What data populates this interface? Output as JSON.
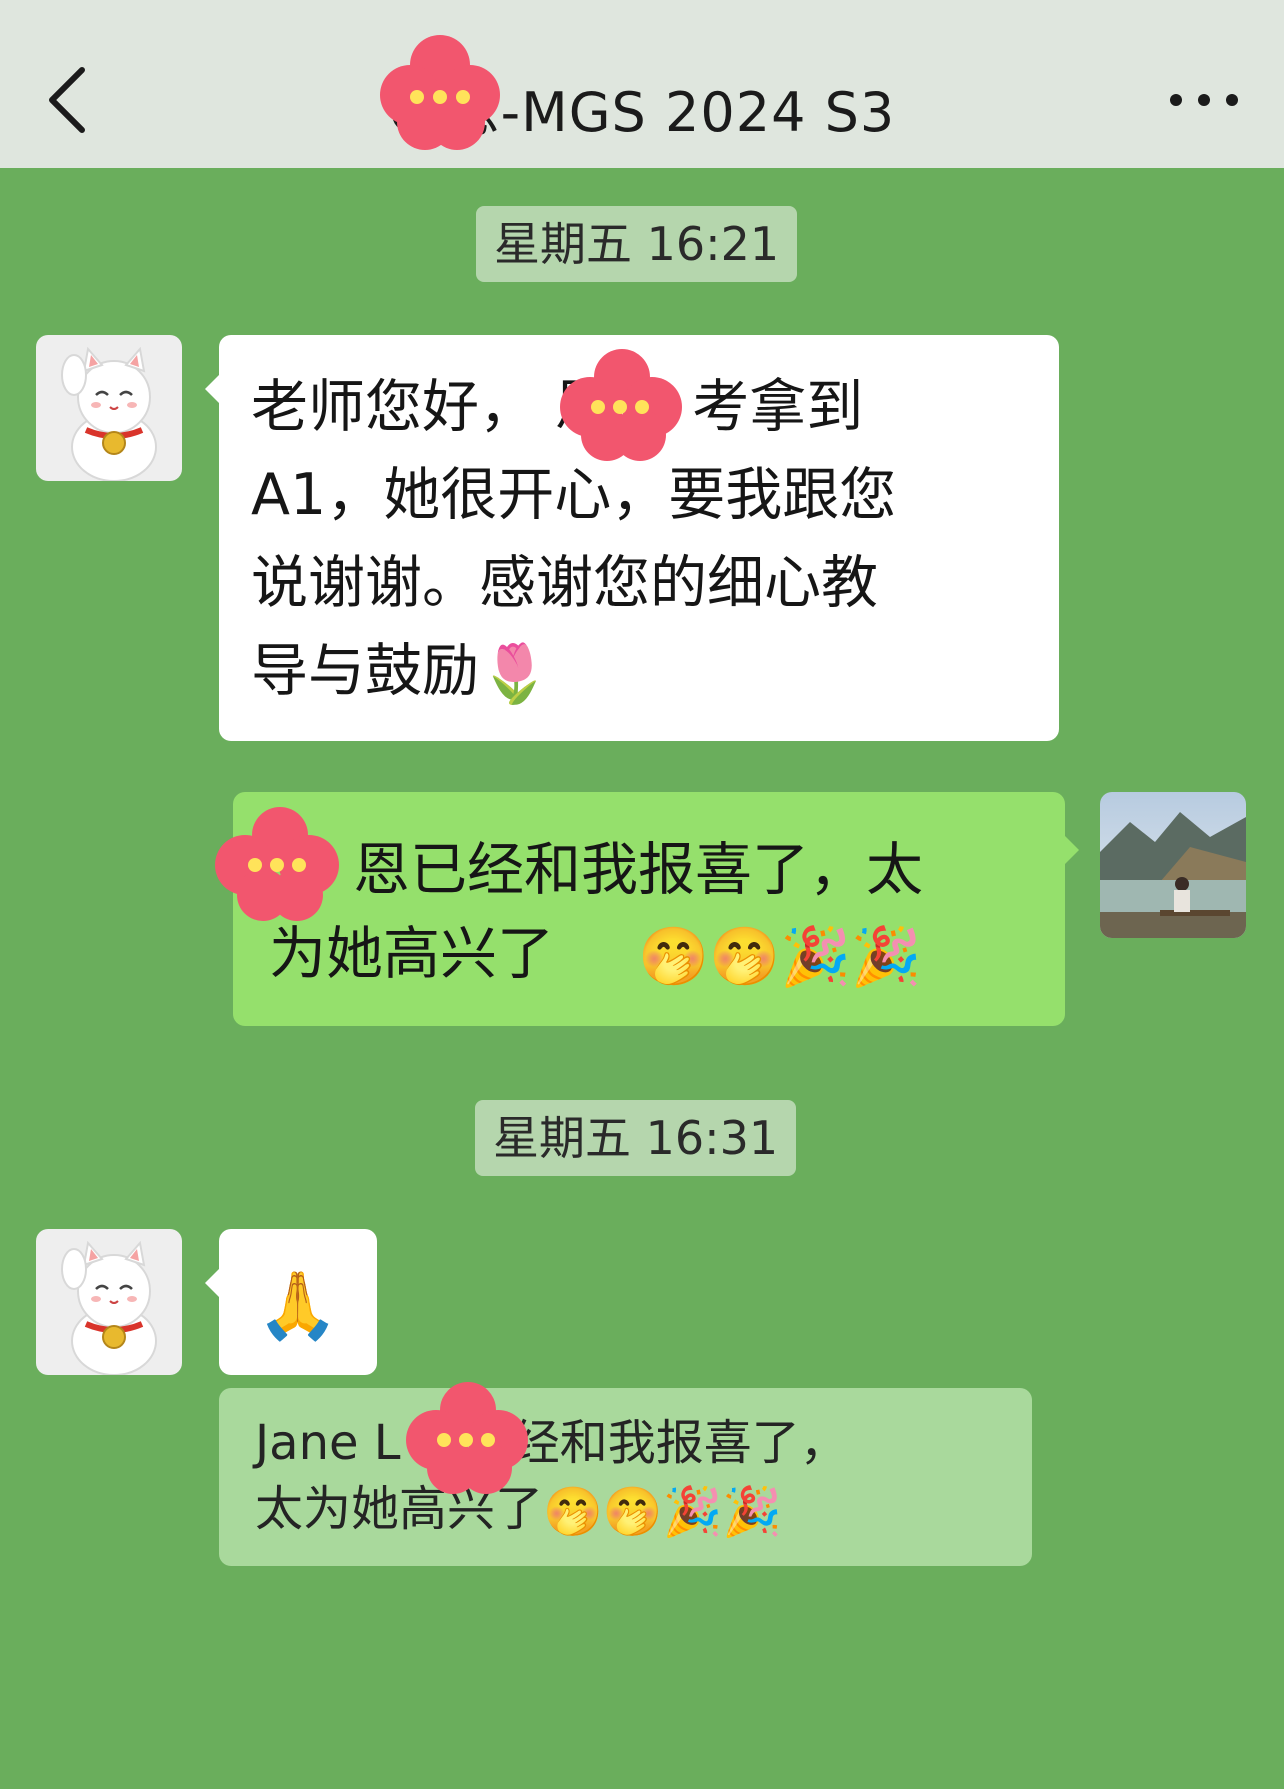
{
  "header": {
    "title": "C 恩-MGS 2024 S3",
    "back_icon": "chevron-left-icon",
    "more_icon": "ellipsis-icon"
  },
  "timestamps": [
    "星期五 16:21",
    "星期五 16:31"
  ],
  "messages": [
    {
      "side": "left",
      "avatar": "lucky-cat-avatar",
      "text": "老师您好， 恩 O 考拿到\nA1，她很开心，要我跟您\n说谢谢。感谢您的细心教\n导与鼓励",
      "emoji": "🌷"
    },
    {
      "side": "right",
      "avatar": "landscape-photo-avatar",
      "text": "恩已经和我报喜了，太\n为她高兴了",
      "emoji": "🤭🤭🎉🎉"
    },
    {
      "side": "left",
      "avatar": "lucky-cat-avatar",
      "text": "🙏"
    }
  ],
  "quote": {
    "text": "Jane L 恩已经和我报喜了，\n太为她高兴了",
    "emoji": "🤭🤭🎉🎉"
  },
  "colors": {
    "background": "#6aae5c",
    "header": "#dfe6de",
    "bubble_self": "#95e06c",
    "bubble_other": "#ffffff",
    "quote": "#a9d99c",
    "timestamp": "#b5d6ad",
    "redaction": "#f2566e"
  }
}
